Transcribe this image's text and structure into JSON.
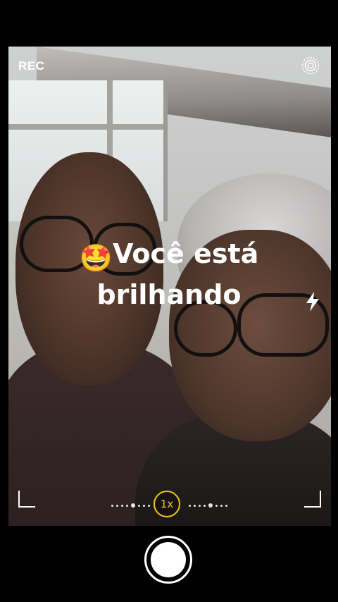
{
  "status": {
    "rec_label": "REC"
  },
  "caption": {
    "emoji": "🤩",
    "line1": "Você está",
    "line2": "brilhando"
  },
  "zoom": {
    "level_label": "1x"
  },
  "icons": {
    "settings": "settings-target-icon",
    "flash": "flash-icon",
    "shutter": "shutter-button"
  },
  "colors": {
    "accent_zoom": "#f5c518",
    "overlay_text": "#ffffff",
    "background": "#000000"
  }
}
